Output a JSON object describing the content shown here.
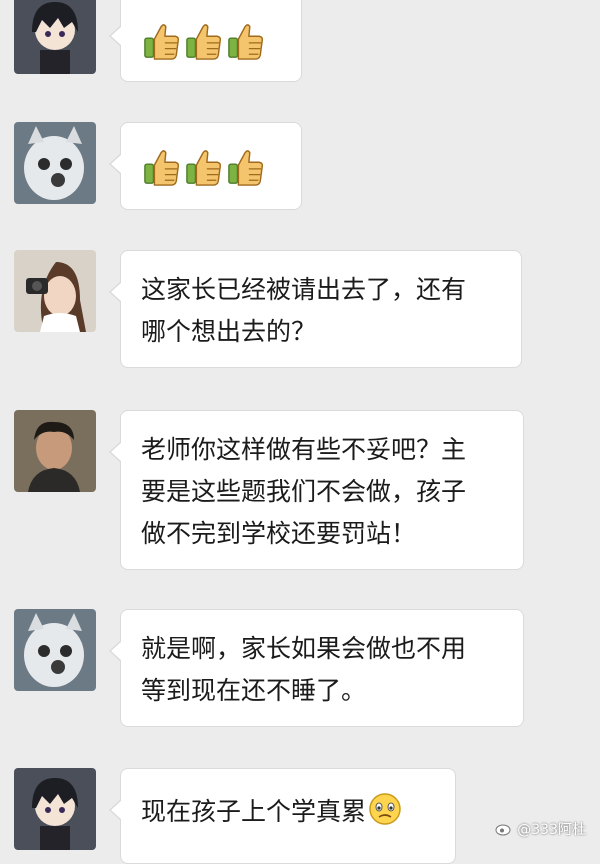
{
  "messages": [
    {
      "sender_avatar": "anime-girl-avatar",
      "type": "emoji",
      "content": [
        "thumbs-up-icon",
        "thumbs-up-icon",
        "thumbs-up-icon"
      ]
    },
    {
      "sender_avatar": "cat-avatar",
      "type": "emoji",
      "content": [
        "thumbs-up-icon",
        "thumbs-up-icon",
        "thumbs-up-icon"
      ]
    },
    {
      "sender_avatar": "girl-camera-avatar",
      "type": "text",
      "text": "这家长已经被请出去了，还有\n哪个想出去的？"
    },
    {
      "sender_avatar": "man-avatar",
      "type": "text",
      "text": "老师你这样做有些不妥吧？主\n要是这些题我们不会做，孩子\n做不完到学校还要罚站！"
    },
    {
      "sender_avatar": "cat-avatar",
      "type": "text",
      "text": "就是啊，家长如果会做也不用\n等到现在还不睡了。"
    },
    {
      "sender_avatar": "anime-girl-avatar",
      "type": "text",
      "text": "现在孩子上个学真累",
      "trailing_emoji": "worried-face-icon"
    }
  ],
  "watermark": {
    "icon": "weibo-icon",
    "text": "@333阿杜"
  },
  "colors": {
    "background": "#ececec",
    "bubble": "#ffffff",
    "bubble_border": "#dadada",
    "text": "#1b1b1b",
    "thumb": "#f2c26b",
    "cuff": "#8bc34a"
  }
}
